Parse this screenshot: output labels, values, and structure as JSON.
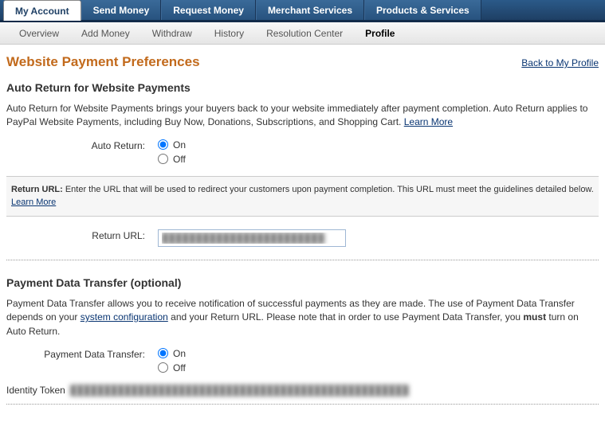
{
  "nav": {
    "tabs": [
      "My Account",
      "Send Money",
      "Request Money",
      "Merchant Services",
      "Products & Services"
    ],
    "active": 0
  },
  "subnav": {
    "items": [
      "Overview",
      "Add Money",
      "Withdraw",
      "History",
      "Resolution Center",
      "Profile"
    ],
    "active": 5
  },
  "page": {
    "title": "Website Payment Preferences",
    "back_link": "Back to My Profile"
  },
  "auto_return": {
    "heading": "Auto Return for Website Payments",
    "body_pre": "Auto Return for Website Payments brings your buyers back to your website immediately after payment completion. Auto Return applies to PayPal Website Payments, including Buy Now, Donations, Subscriptions, and Shopping Cart. ",
    "learn_more": "Learn More",
    "label": "Auto Return:",
    "on": "On",
    "off": "Off",
    "info_label": "Return URL:",
    "info_text": " Enter the URL that will be used to redirect your customers upon payment completion. This URL must meet the guidelines detailed below. ",
    "info_learn": "Learn More",
    "return_url_label": "Return URL:",
    "return_url_value": "████████████████████████"
  },
  "pdt": {
    "heading": "Payment Data Transfer (optional)",
    "body_pre": "Payment Data Transfer allows you to receive notification of successful payments as they are made. The use of Payment Data Transfer depends on your ",
    "sys_conf": "system configuration",
    "body_mid": " and your Return URL. Please note that in order to use Payment Data Transfer, you ",
    "must": "must",
    "body_post": " turn on Auto Return.",
    "label": "Payment Data Transfer:",
    "on": "On",
    "off": "Off",
    "token_label": "Identity Token",
    "token_value": "██████████████████████████████████████████████████"
  }
}
